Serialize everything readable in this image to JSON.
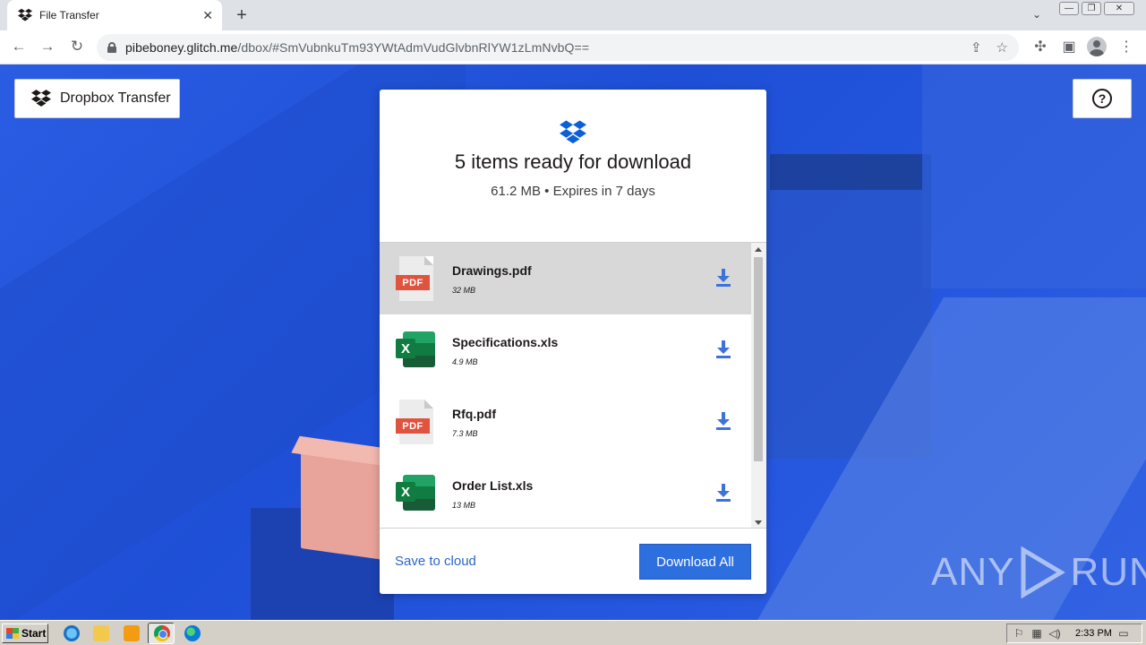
{
  "browser": {
    "tab_title": "File Transfer",
    "tab_close": "✕",
    "new_tab": "+",
    "tab_search": "⌄",
    "url_host": "pibeboney.glitch.me",
    "url_rest": "/dbox/#SmVubnkuTm93YWtAdmVudGlvbnRlYW1zLmNvbQ==",
    "window_controls": [
      "—",
      "❐",
      "✕"
    ]
  },
  "header": {
    "brand_label": "Dropbox Transfer",
    "help_label": "?"
  },
  "card": {
    "title": "5 items ready for download",
    "subtitle": "61.2 MB • Expires in 7 days",
    "files": [
      {
        "name": "Drawings.pdf",
        "size": "32 MB",
        "type": "pdf",
        "type_label": "PDF"
      },
      {
        "name": "Specifications.xls",
        "size": "4.9 MB",
        "type": "xls",
        "type_label": "X"
      },
      {
        "name": "Rfq.pdf",
        "size": "7.3 MB",
        "type": "pdf",
        "type_label": "PDF"
      },
      {
        "name": "Order List.xls",
        "size": "13 MB",
        "type": "xls",
        "type_label": "X"
      }
    ],
    "save_to_cloud": "Save to cloud",
    "download_all": "Download All"
  },
  "watermark": {
    "left": "ANY",
    "right": "RUN"
  },
  "taskbar": {
    "start_label": "Start",
    "clock": "2:33 PM"
  },
  "colors": {
    "accent": "#2e6fe0",
    "link": "#2e64c8",
    "pdf_red": "#e0533f",
    "excel_green": "#107c41"
  }
}
